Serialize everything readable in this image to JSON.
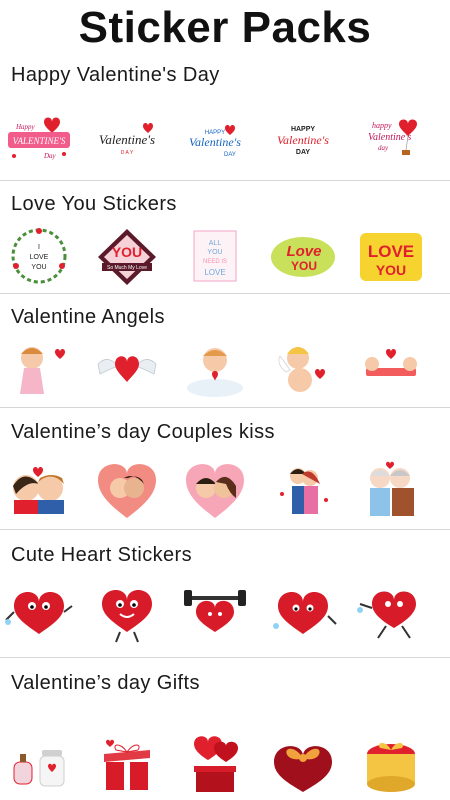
{
  "app": {
    "title": "Sticker Packs"
  },
  "packs": [
    {
      "title": "Happy Valentine's Day"
    },
    {
      "title": "Love You Stickers"
    },
    {
      "title": "Valentine Angels"
    },
    {
      "title": "Valentine’s day Couples kiss"
    },
    {
      "title": "Cute Heart Stickers"
    },
    {
      "title": "Valentine’s day Gifts"
    }
  ],
  "colors": {
    "heart": "#e0202d",
    "pink": "#f25c8a",
    "divider": "#d6d6d6"
  }
}
